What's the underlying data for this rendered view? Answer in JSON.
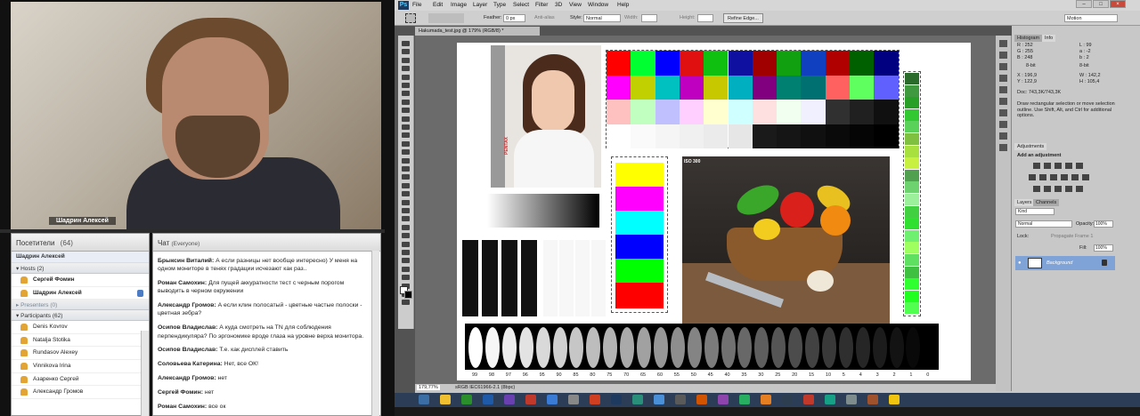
{
  "video": {
    "presenter_name": "Шадрин Алексей"
  },
  "attendees": {
    "title": "Посетители",
    "count": "(64)",
    "me": "Шадрин Алексей",
    "groups": {
      "hosts": "Hosts (2)",
      "presenters": "Presenters (0)",
      "participants": "Participants (62)"
    },
    "hosts": [
      "Сергей Фомин",
      "Шадрин Алексей"
    ],
    "participants": [
      "Denis Kovrov",
      "Natalja Stotika",
      "Rundasov Alexey",
      "Vinnikova Irina",
      "Азаренко Сергей",
      "Александр Громов"
    ]
  },
  "chat": {
    "title": "Чат",
    "scope": "(Everyone)",
    "messages": [
      {
        "author": "Брыксин Виталий:",
        "text": "А если разницы нет вообще интересно) У меня на одном мониторе в тенях градации исчезают как раз.."
      },
      {
        "author": "Роман Самохин:",
        "text": "Для пущей аккуратности тест с черным порогом выводить в черном окружении"
      },
      {
        "author": "Александр Громов:",
        "text": "А если клин полосатый - цветные частые полоски - цветная зебра?"
      },
      {
        "author": "Осипов Владислав:",
        "text": "А куда смотреть на TN для соблюдения перпендикуляра? По эргономике вроде глаза на уровне верха монитора."
      },
      {
        "author": "Осипов Владислав:",
        "text": "Т.е. как дисплей ставить"
      },
      {
        "author": "Соловьева Катерина:",
        "text": "Нет, все ОК!"
      },
      {
        "author": "Александр Громов:",
        "text": "нет"
      },
      {
        "author": "Сергей Фомин:",
        "text": "нет"
      },
      {
        "author": "Роман Самохин:",
        "text": "все ок"
      }
    ]
  },
  "photoshop": {
    "logo": "Ps",
    "menu": [
      "File",
      "Edit",
      "Image",
      "Layer",
      "Type",
      "Select",
      "Filter",
      "3D",
      "View",
      "Window",
      "Help"
    ],
    "options": {
      "feather_label": "Feather:",
      "feather_value": "0 px",
      "antialias": "Anti-alias",
      "style_label": "Style:",
      "style_value": "Normal",
      "width_label": "Width:",
      "height_label": "Height:",
      "refine_button": "Refine Edge...",
      "workspace": "Motion"
    },
    "document_tab": "Hakumada_test.jpg @ 179% (RGB/8) *",
    "status": {
      "zoom": "179,77%",
      "profile": "sRGB IEC61966-2.1 (8bpc)"
    },
    "doc_labels": {
      "iso": "ISO 300",
      "brand": "PENTAX"
    },
    "gray_scale_labels": [
      "99",
      "98",
      "97",
      "96",
      "95",
      "90",
      "85",
      "80",
      "75",
      "70",
      "65",
      "60",
      "55",
      "50",
      "45",
      "40",
      "35",
      "30",
      "25",
      "20",
      "15",
      "10",
      "5",
      "4",
      "3",
      "2",
      "1",
      "0"
    ],
    "panels": {
      "tabs_top": [
        "Histogram",
        "Info"
      ],
      "info": {
        "r": "R :",
        "r_val": "252",
        "g": "G :",
        "g_val": "255",
        "b": "B :",
        "b_val": "248",
        "l": "L :",
        "l_val": "99",
        "a": "a :",
        "a_val": "-2",
        "bb": "b :",
        "bb_val": "2",
        "bit1": "8-bit",
        "bit2": "8-bit",
        "x": "X :",
        "x_val": "196,9",
        "y": "Y :",
        "y_val": "122,9",
        "w": "W :",
        "w_val": "142,2",
        "h": "H :",
        "h_val": "105,4",
        "doc": "Doc: 743,3K/743,3K",
        "hint": "Draw rectangular selection or move selection outline.  Use Shift, Alt, and Ctrl for additional options."
      },
      "adjustments_tab": "Adjustments",
      "adjustments_title": "Add an adjustment",
      "layers_tabs": [
        "Layers",
        "Channels"
      ],
      "layers_kind": "Kind",
      "layers_mode": "Normal",
      "layers_opacity_label": "Opacity:",
      "layers_opacity": "100%",
      "layers_lock": "Lock:",
      "layers_fill_label": "Fill:",
      "layers_fill": "100%",
      "propagate": "Propagate Frame 1",
      "layer_name": "Background"
    }
  },
  "colors": {
    "ps_bg": "#535353",
    "accent": "#7fa3d6"
  }
}
